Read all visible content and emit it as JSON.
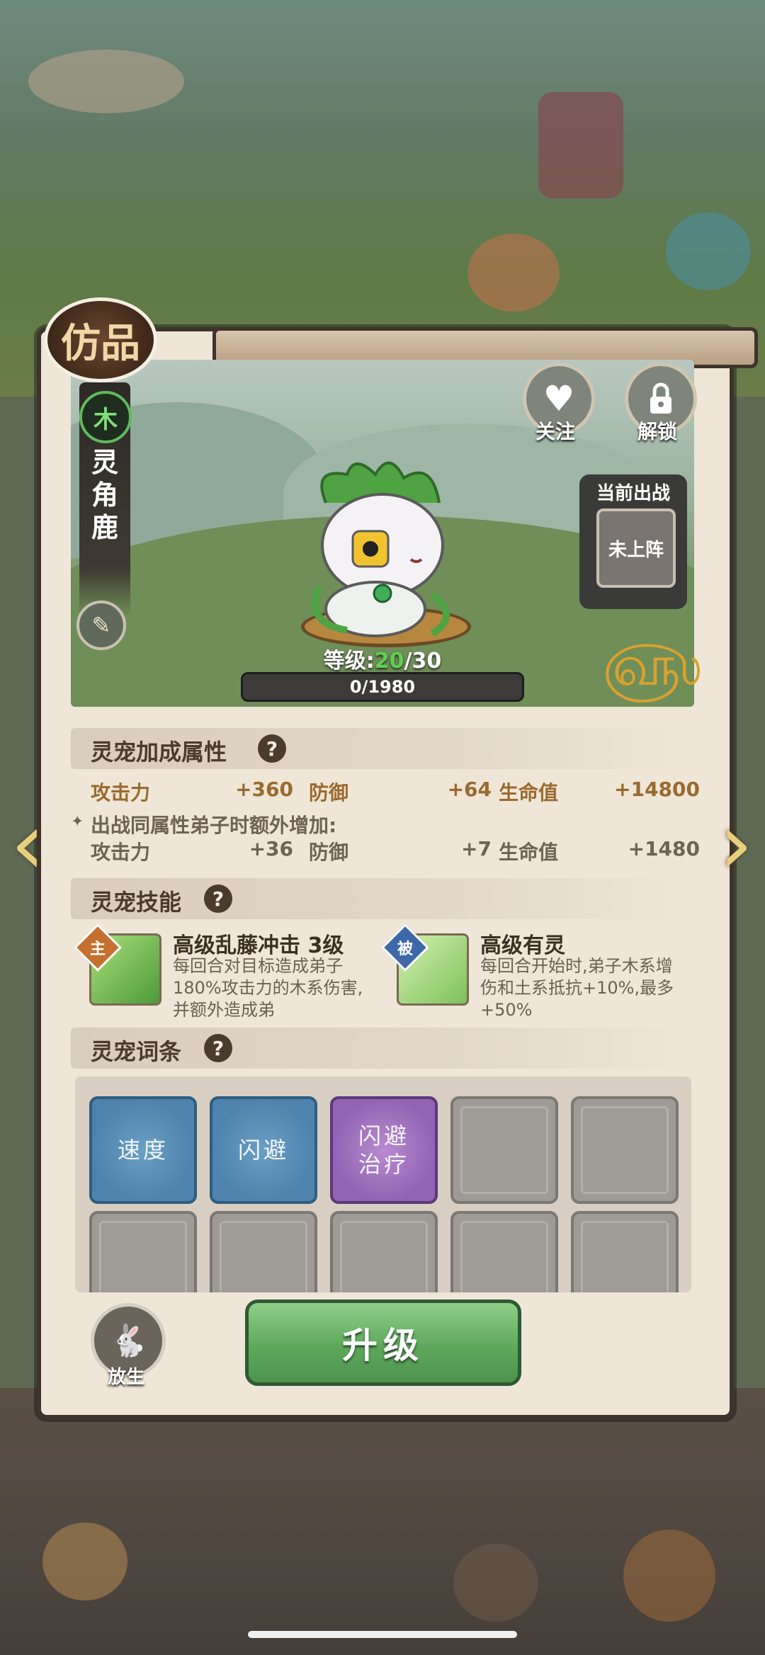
{
  "grade_badge": "仿品",
  "pet": {
    "element": "木",
    "name": "灵角鹿",
    "level_label": "等级:",
    "level_current": "20",
    "level_max": "/30",
    "exp_text": "0/1980",
    "exp_progress": 0
  },
  "actions": {
    "follow_label": "关注",
    "unlock_label": "解锁"
  },
  "deploy": {
    "title": "当前出战",
    "status": "未上阵"
  },
  "attributes": {
    "title": "灵宠加成属性",
    "help": "?",
    "base": [
      {
        "name": "攻击力",
        "value": "+360"
      },
      {
        "name": "防御",
        "value": "+64"
      },
      {
        "name": "生命值",
        "value": "+14800"
      }
    ],
    "bonus_note": "出战同属性弟子时额外增加:",
    "bonus": [
      {
        "name": "攻击力",
        "value": "+36"
      },
      {
        "name": "防御",
        "value": "+7"
      },
      {
        "name": "生命值",
        "value": "+1480"
      }
    ]
  },
  "skills": {
    "title": "灵宠技能",
    "help": "?",
    "items": [
      {
        "tag": "主",
        "name": "高级乱藤冲击 3级",
        "desc": "每回合对目标造成弟子180%攻击力的木系伤害,并额外造成弟"
      },
      {
        "tag": "被",
        "name": "高级有灵",
        "desc": "每回合开始时,弟子木系增伤和土系抵抗+10%,最多+50%"
      }
    ]
  },
  "traits": {
    "title": "灵宠词条",
    "help": "?",
    "slots": [
      {
        "label": "速度",
        "style": "blue"
      },
      {
        "label": "闪避",
        "style": "blue"
      },
      {
        "label": "闪避治疗",
        "style": "purple"
      }
    ]
  },
  "buttons": {
    "release_label": "放生",
    "upgrade_label": "升级"
  },
  "colors": {
    "panel": "#efe6d7",
    "gold_text": "#9a6a2f",
    "level_green": "#5fcf52",
    "upgrade_green": "#5ea85c"
  }
}
